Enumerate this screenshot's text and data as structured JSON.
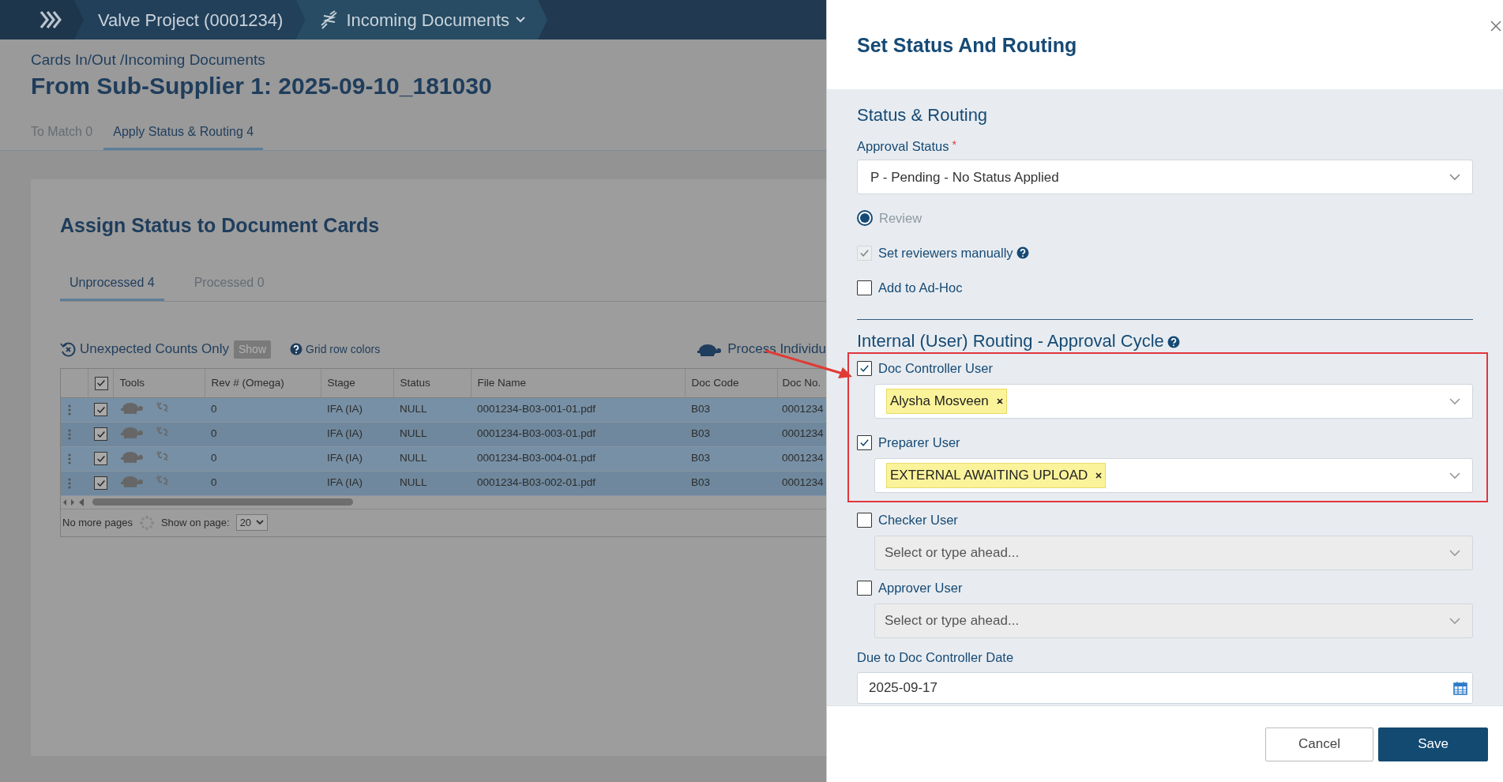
{
  "header": {
    "crumbs": [
      {
        "label": "Valve Project (0001234)",
        "kind": "plain"
      },
      {
        "label": "Incoming Documents",
        "kind": "dropdown"
      }
    ]
  },
  "page": {
    "breadcrumb": "Cards In/Out /Incoming Documents",
    "title": "From Sub-Supplier 1: 2025-09-10_181030"
  },
  "tabs": [
    {
      "label": "To Match 0",
      "selected": false
    },
    {
      "label": "Apply Status & Routing 4",
      "selected": true
    }
  ],
  "panel": {
    "title": "Assign Status to Document Cards",
    "tabs": [
      {
        "label": "Unprocessed 4",
        "selected": true
      },
      {
        "label": "Processed 0",
        "selected": false
      }
    ],
    "toolbar": {
      "unexpected": "Unexpected Counts Only",
      "show": "Show",
      "grid_colors": "Grid row colors",
      "process": "Process Individu"
    }
  },
  "grid": {
    "header_checked": true,
    "tools_header": "Tools",
    "columns": [
      "Rev # (Omega)",
      "Stage",
      "Status",
      "File Name",
      "Doc Code",
      "Doc No."
    ],
    "rows": [
      {
        "checked": true,
        "cells": [
          "0",
          "IFA (IA)",
          "NULL",
          "0001234-B03-001-01.pdf",
          "B03",
          "0001234"
        ]
      },
      {
        "checked": true,
        "cells": [
          "0",
          "IFA (IA)",
          "NULL",
          "0001234-B03-003-01.pdf",
          "B03",
          "0001234"
        ]
      },
      {
        "checked": true,
        "cells": [
          "0",
          "IFA (IA)",
          "NULL",
          "0001234-B03-004-01.pdf",
          "B03",
          "0001234"
        ]
      },
      {
        "checked": true,
        "cells": [
          "0",
          "IFA (IA)",
          "NULL",
          "0001234-B03-002-01.pdf",
          "B03",
          "0001234"
        ]
      }
    ],
    "footer": {
      "pages": "No more pages",
      "show_label": "Show on page:",
      "page_size": "20"
    }
  },
  "dialog": {
    "title": "Set Status And Routing",
    "section": "Status & Routing",
    "approval": {
      "label": "Approval Status",
      "required": "*",
      "value": "P - Pending - No Status Applied"
    },
    "options": [
      {
        "kind": "radio",
        "label": "Review",
        "checked": true,
        "disabled": true,
        "help": false
      },
      {
        "kind": "checkbox",
        "label": "Set reviewers manually",
        "checked": true,
        "disabled": true,
        "help": true
      },
      {
        "kind": "checkbox",
        "label": "Add to Ad-Hoc",
        "checked": false,
        "disabled": false,
        "help": false
      }
    ],
    "routing_title": "Internal (User) Routing - Approval Cycle",
    "users": [
      {
        "label": "Doc Controller User",
        "checked": true,
        "highlighted": true,
        "tags": [
          "Alysha Mosveen"
        ]
      },
      {
        "label": "Preparer User",
        "checked": true,
        "highlighted": true,
        "tags": [
          "EXTERNAL AWAITING UPLOAD"
        ]
      },
      {
        "label": "Checker User",
        "checked": false,
        "highlighted": false,
        "placeholder": "Select or type ahead..."
      },
      {
        "label": "Approver User",
        "checked": false,
        "highlighted": false,
        "placeholder": "Select or type ahead..."
      }
    ],
    "due": {
      "label": "Due to Doc Controller Date",
      "value": "2025-09-17"
    },
    "buttons": [
      {
        "label": "Cancel",
        "kind": "secondary"
      },
      {
        "label": "Save",
        "kind": "primary"
      }
    ]
  }
}
